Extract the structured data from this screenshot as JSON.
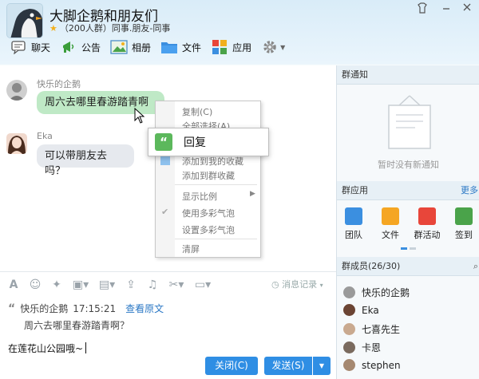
{
  "header": {
    "title": "大脚企鹅和朋友们",
    "subtitle": "（200人群）同事.朋友-同事"
  },
  "toolbar": {
    "items": [
      {
        "label": "聊天",
        "icon": "chat-icon"
      },
      {
        "label": "公告",
        "icon": "announce-icon"
      },
      {
        "label": "相册",
        "icon": "album-icon"
      },
      {
        "label": "文件",
        "icon": "folder-icon"
      },
      {
        "label": "应用",
        "icon": "apps-icon"
      }
    ]
  },
  "messages": [
    {
      "sender": "快乐的企鹅",
      "text": "周六去哪里春游踏青啊"
    },
    {
      "sender": "Eka",
      "text": "可以带朋友去吗？"
    }
  ],
  "context_menu": {
    "items": [
      "复制(C)",
      "全部选择(A)",
      "添加到我的收藏",
      "添加到群收藏",
      "显示比例",
      "使用多彩气泡",
      "设置多彩气泡",
      "清屏"
    ],
    "reply_label": "回复"
  },
  "input_area": {
    "history_label": "消息记录",
    "quote_sender": "快乐的企鹅",
    "quote_time": "17:15:21",
    "quote_link": "查看原文",
    "quote_text": "周六去哪里春游踏青啊？",
    "typed_text": "在莲花山公园哦~",
    "close_button": "关闭(C)",
    "send_button": "发送(S)"
  },
  "right_panel": {
    "notice_title": "群通知",
    "notice_empty": "暂时没有新通知",
    "apps_title": "群应用",
    "apps_more": "更多",
    "apps": [
      "团队",
      "文件",
      "群活动",
      "签到"
    ],
    "members_title": "群成员(26/30)",
    "members": [
      "快乐的企鹅",
      "Eka",
      "七喜先生",
      "卡恩",
      "stephen"
    ]
  },
  "colors": {
    "accent": "#2f8ee4",
    "bubble_green": "#bfe9c6",
    "bubble_gray": "#e6e9ee",
    "link": "#2b78c5"
  }
}
